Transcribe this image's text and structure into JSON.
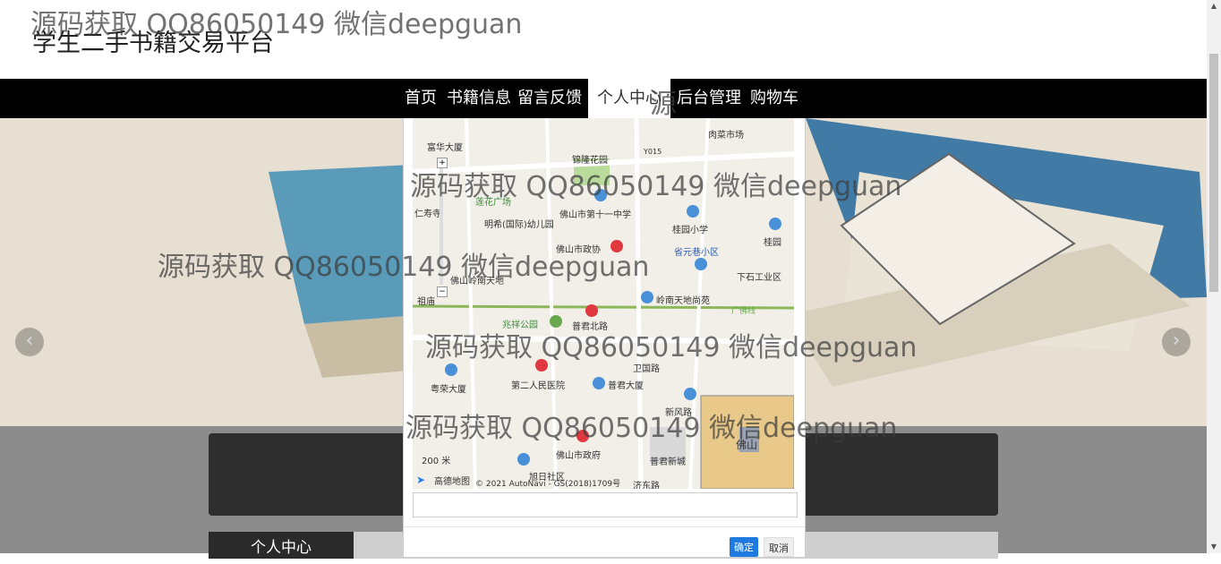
{
  "watermark": "源码获取 QQ86050149 微信deepguan",
  "watermark_partial": "源码获取 QQ86050149 微信deepguan",
  "site_title": "学生二手书籍交易平台",
  "nav": [
    {
      "label": "首页"
    },
    {
      "label": "书籍信息"
    },
    {
      "label": "留言反馈"
    },
    {
      "label": "个人中心",
      "active": true
    },
    {
      "label": "后台管理"
    },
    {
      "label": "购物车"
    }
  ],
  "nav_overlap": "源",
  "carousel": {
    "prev_icon": "‹",
    "next_icon": "›"
  },
  "sidebar": {
    "title": "个人中心"
  },
  "map": {
    "labels": [
      "富华大厦",
      "肉菜市场",
      "锦隆花园",
      "Y015",
      "莲花广场",
      "佛山市第十一中学",
      "仁寿寺",
      "明希(国际)幼儿园",
      "桂园小学",
      "桂园",
      "佛山市政协",
      "省元巷小区",
      "佛山岭南天地",
      "下石工业区",
      "祖庙",
      "岭南天地尚苑",
      "广佛线",
      "兆祥公园",
      "普君北路",
      "卫国路",
      "粤荣大厦",
      "第二人民医院",
      "普君大厦",
      "新风路",
      "佛山市政府",
      "旭日社区",
      "普君新城",
      "佛山",
      "200 米",
      "高德地图",
      "© 2021 AutoNavi - GS(2018)1709号",
      "济东路"
    ],
    "zoom_in": "+",
    "zoom_out": "−"
  },
  "dialog": {
    "input_value": "",
    "ok_label": "确定",
    "cancel_label": "取消"
  }
}
